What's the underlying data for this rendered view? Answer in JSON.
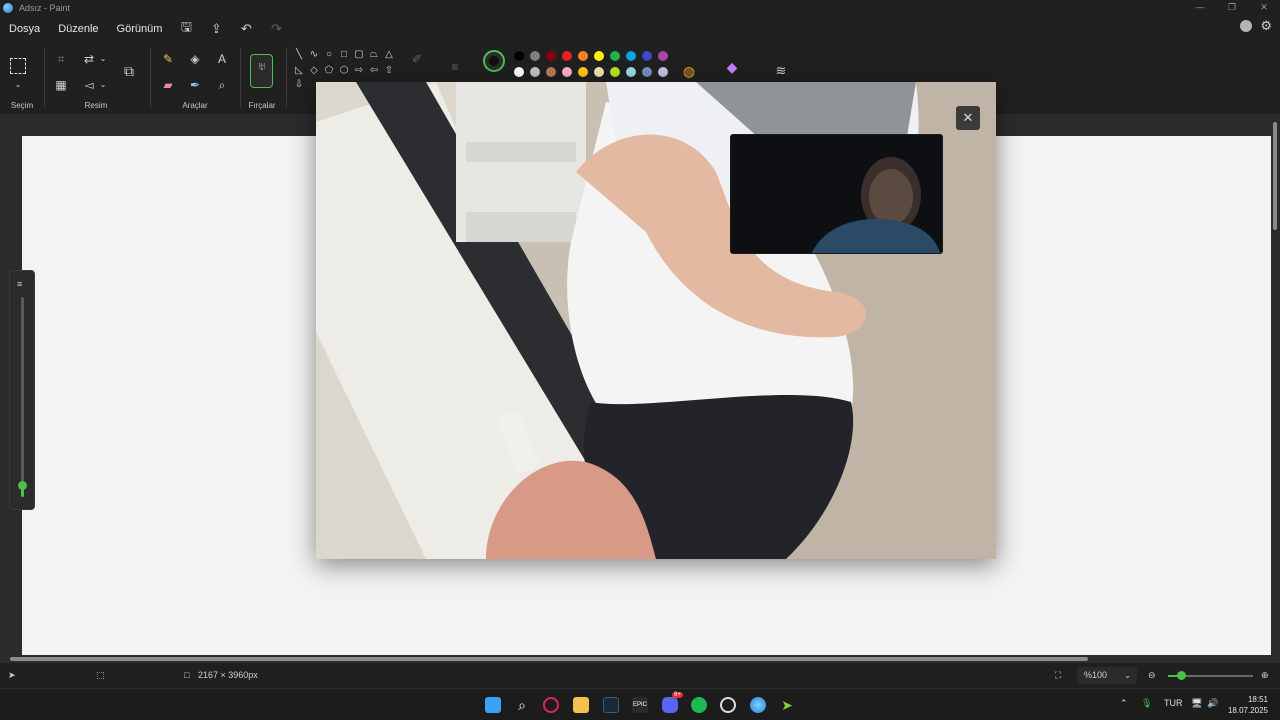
{
  "window": {
    "title": "Adsız - Paint"
  },
  "menu": {
    "file": "Dosya",
    "edit": "Düzenle",
    "view": "Görünüm"
  },
  "ribbon": {
    "selection_label": "Seçim",
    "image_label": "Resim",
    "tools_label": "Araçlar",
    "brushes_label": "Fırçalar"
  },
  "colors": {
    "current": "#111111",
    "accent": "#47c24d",
    "palette_row1": [
      "#000000",
      "#7f7f7f",
      "#880015",
      "#ed1c24",
      "#ff7f27",
      "#fff200",
      "#22b14c",
      "#00a2e8",
      "#3f48cc",
      "#a349a4"
    ],
    "palette_row2": [
      "#ffffff",
      "#c3c3c3",
      "#b97a57",
      "#ffaec9",
      "#ffc90e",
      "#efe4b0",
      "#b5e61d",
      "#99d9ea",
      "#7092be",
      "#c8bfe7"
    ]
  },
  "viewer": {
    "close_glyph": "✕"
  },
  "status": {
    "dimensions": "2167 × 3960px",
    "zoom": "%100"
  },
  "taskbar": {
    "language": "TUR",
    "time": "18:51",
    "date": "18.07.2025",
    "discord_badge": "9+"
  }
}
